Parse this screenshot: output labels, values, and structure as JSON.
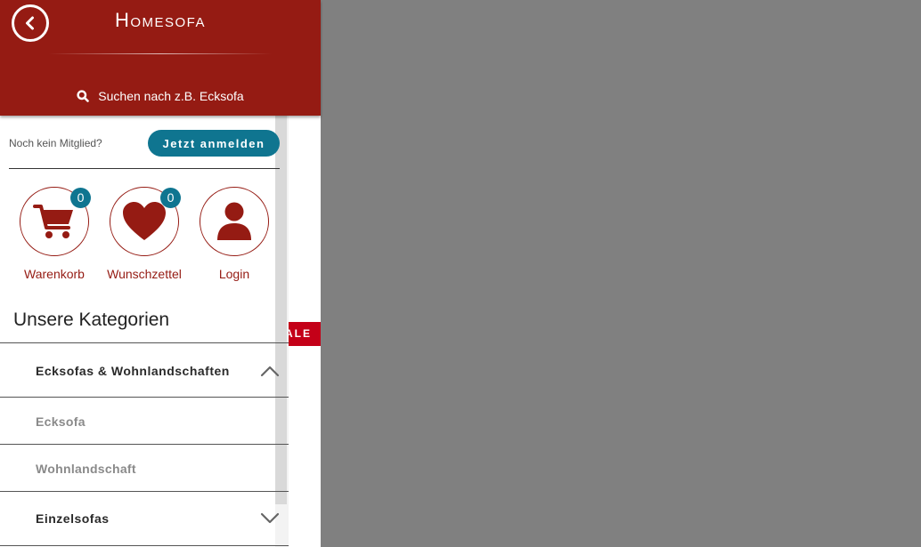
{
  "header": {
    "brand": "Homesofa",
    "search_placeholder": "Suchen nach z.B. Ecksofa"
  },
  "membership": {
    "prompt": "Noch kein Mitglied?",
    "signup_label": "Jetzt anmelden"
  },
  "quick_links": [
    {
      "label": "Warenkorb",
      "badge": "0",
      "icon": "cart-icon"
    },
    {
      "label": "Wunschzettel",
      "badge": "0",
      "icon": "heart-icon"
    },
    {
      "label": "Login",
      "icon": "user-icon"
    }
  ],
  "categories": {
    "heading": "Unsere Kategorien",
    "items": [
      {
        "label": "Ecksofas & Wohnlandschaften",
        "expanded": true,
        "icon": "chevron-up-icon"
      },
      {
        "label": "Ecksofa",
        "level": "sub"
      },
      {
        "label": "Wohnlandschaft",
        "level": "sub"
      },
      {
        "label": "Einzelsofas",
        "expanded": false,
        "icon": "chevron-down-icon"
      }
    ]
  },
  "background": {
    "sale_label": "ALE"
  },
  "colors": {
    "brand_red": "#951b13",
    "accent_blue": "#0f7590",
    "overlay": "#808080",
    "sale_red": "#c40018"
  }
}
